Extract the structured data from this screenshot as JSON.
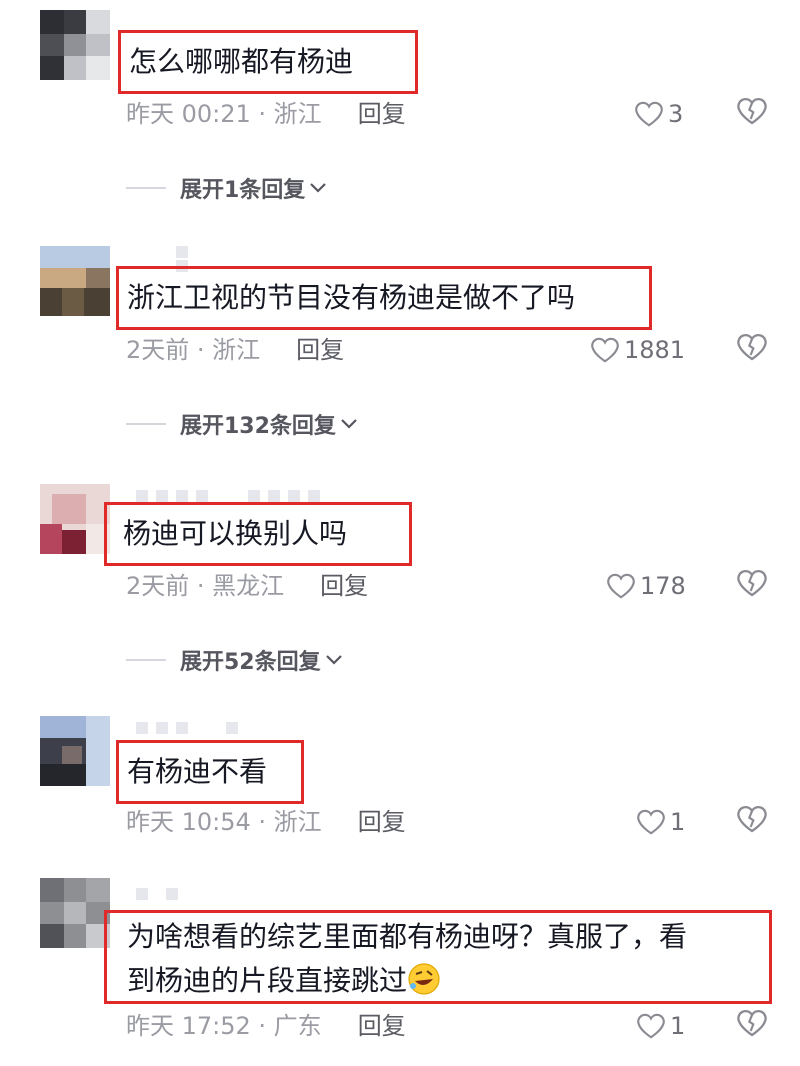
{
  "comments": [
    {
      "text": "怎么哪哪都有杨迪",
      "time": "昨天 00:21 · 浙江",
      "reply": "回复",
      "likes": "3",
      "expand": "展开1条回复"
    },
    {
      "text": "浙江卫视的节目没有杨迪是做不了吗",
      "time": "2天前 · 浙江",
      "reply": "回复",
      "likes": "1881",
      "expand": "展开132条回复"
    },
    {
      "text": "杨迪可以换别人吗",
      "time": "2天前 · 黑龙江",
      "reply": "回复",
      "likes": "178",
      "expand": "展开52条回复"
    },
    {
      "text": "有杨迪不看",
      "time": "昨天 10:54 · 浙江",
      "reply": "回复",
      "likes": "1"
    },
    {
      "text_line1": "为啥想看的综艺里面都有杨迪呀？真服了，看",
      "text_line2": "到杨迪的片段直接跳过",
      "time": "昨天 17:52 · 广东",
      "reply": "回复",
      "likes": "1"
    }
  ],
  "icons": {
    "like": "heart-outline-icon",
    "dislike": "broken-heart-icon",
    "expand": "chevron-down-icon",
    "emoji": "rofl-emoji-icon"
  },
  "colors": {
    "highlight_box": "#e02a2a",
    "meta_text": "#9a9ba3"
  }
}
